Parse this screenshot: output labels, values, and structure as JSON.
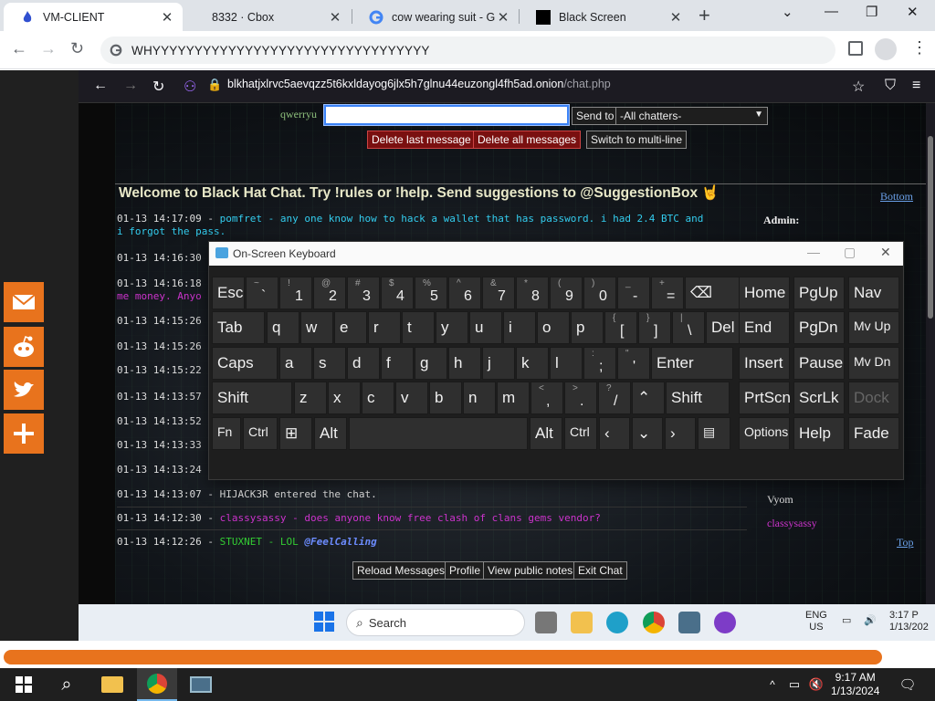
{
  "browser": {
    "tabs": [
      {
        "title": "VM-CLIENT",
        "active": true
      },
      {
        "title": "8332 · Cbox",
        "active": false
      },
      {
        "title": "cow wearing suit - Goo",
        "active": false
      },
      {
        "title": "Black Screen",
        "active": false
      }
    ],
    "new_tab": "+",
    "url": "WHYYYYYYYYYYYYYYYYYYYYYYYYYYYYYYYYY"
  },
  "firefox": {
    "url_host": "blkhatjxlrvc5aevqzz5t6kxldayog6jlx5h7glnu44euzongl4fh5ad.onion",
    "url_path": "/chat.php"
  },
  "chat": {
    "nick": "qwerryu",
    "send_to_label": "Send to",
    "send_to_value": "-All chatters-",
    "delete_last": "Delete last message",
    "delete_all": "Delete all messages",
    "switch_multi": "Switch to multi-line",
    "welcome": "Welcome to Black Hat Chat. Try !rules or !help. Send suggestions to @SuggestionBox 🤘",
    "bottom_link": "Bottom",
    "top_link": "Top",
    "messages": [
      {
        "ts": "01-13 14:17:09",
        "user": "pomfret",
        "text": "any one know how to hack a wallet that has password. i had 2.4 BTC and",
        "cont": "i forgot the pass."
      },
      {
        "ts": "01-13 14:16:30",
        "user": "",
        "text": ""
      },
      {
        "ts": "01-13 14:16:18",
        "user": "",
        "text": "",
        "cont": "me money. Anyo"
      },
      {
        "ts": "01-13 14:15:26",
        "user": "",
        "text": ""
      },
      {
        "ts": "01-13 14:15:26",
        "user": "",
        "text": ""
      },
      {
        "ts": "01-13 14:15:22",
        "user": "",
        "text": ""
      },
      {
        "ts": "01-13 14:13:57",
        "user": "",
        "text": ""
      },
      {
        "ts": "01-13 14:13:52",
        "user": "",
        "text": ""
      },
      {
        "ts": "01-13 14:13:33",
        "user": "",
        "text": ""
      },
      {
        "ts": "01-13 14:13:24",
        "user": "",
        "text": ""
      },
      {
        "ts": "01-13 14:13:07",
        "user": "HIJACK3R",
        "text": "entered the chat."
      },
      {
        "ts": "01-13 14:12:30",
        "user": "classysassy",
        "text": "does anyone know free clash of clans gems vendor?"
      },
      {
        "ts": "01-13 14:12:26",
        "user": "STUXNET",
        "text": "LOL",
        "mention": "@FeelCalling"
      }
    ],
    "sidebar": {
      "admin_label": "Admin:",
      "users": [
        "Vyom",
        "classysassy"
      ]
    },
    "buttons": {
      "reload": "Reload Messages",
      "profile": "Profile",
      "notes": "View public notes",
      "exit": "Exit Chat"
    }
  },
  "osk": {
    "title": "On-Screen Keyboard",
    "keys": {
      "esc": "Esc",
      "tab": "Tab",
      "caps": "Caps",
      "shift": "Shift",
      "fn": "Fn",
      "ctrl": "Ctrl",
      "alt": "Alt",
      "del": "Del",
      "enter": "Enter",
      "home": "Home",
      "pgup": "PgUp",
      "nav": "Nav",
      "end": "End",
      "pgdn": "PgDn",
      "mvup": "Mv Up",
      "insert": "Insert",
      "pause": "Pause",
      "mvdn": "Mv Dn",
      "prtscn": "PrtScn",
      "scrlk": "ScrLk",
      "dock": "Dock",
      "options": "Options",
      "help": "Help",
      "fade": "Fade"
    },
    "row1": [
      [
        "~",
        "`"
      ],
      [
        "!",
        "1"
      ],
      [
        "@",
        "2"
      ],
      [
        "#",
        "3"
      ],
      [
        "$",
        "4"
      ],
      [
        "%",
        "5"
      ],
      [
        "^",
        "6"
      ],
      [
        "&",
        "7"
      ],
      [
        "*",
        "8"
      ],
      [
        "(",
        "9"
      ],
      [
        ")",
        "0"
      ],
      [
        "_",
        "-"
      ],
      [
        "+",
        "="
      ]
    ],
    "row2": [
      "q",
      "w",
      "e",
      "r",
      "t",
      "y",
      "u",
      "i",
      "o",
      "p"
    ],
    "row2b": [
      [
        "{",
        "["
      ],
      [
        "}",
        "]"
      ],
      [
        "|",
        "\\"
      ]
    ],
    "row3": [
      "a",
      "s",
      "d",
      "f",
      "g",
      "h",
      "j",
      "k",
      "l"
    ],
    "row3b": [
      [
        ":",
        ";"
      ],
      [
        "\"",
        "'"
      ]
    ],
    "row4": [
      "z",
      "x",
      "c",
      "v",
      "b",
      "n",
      "m"
    ],
    "row4b": [
      [
        "<",
        ","
      ],
      [
        ">",
        "."
      ],
      [
        "?",
        "/"
      ]
    ]
  },
  "vm_taskbar": {
    "search": "Search",
    "lang": "ENG",
    "region": "US",
    "time": "3:17 P",
    "date": "1/13/202"
  },
  "host_taskbar": {
    "time": "9:17 AM",
    "date": "1/13/2024"
  },
  "colors": {
    "share_orange": "#e8731d",
    "user_cyan": "#33ccee",
    "user_pink": "#cc33cc",
    "user_green": "#33cc33"
  }
}
